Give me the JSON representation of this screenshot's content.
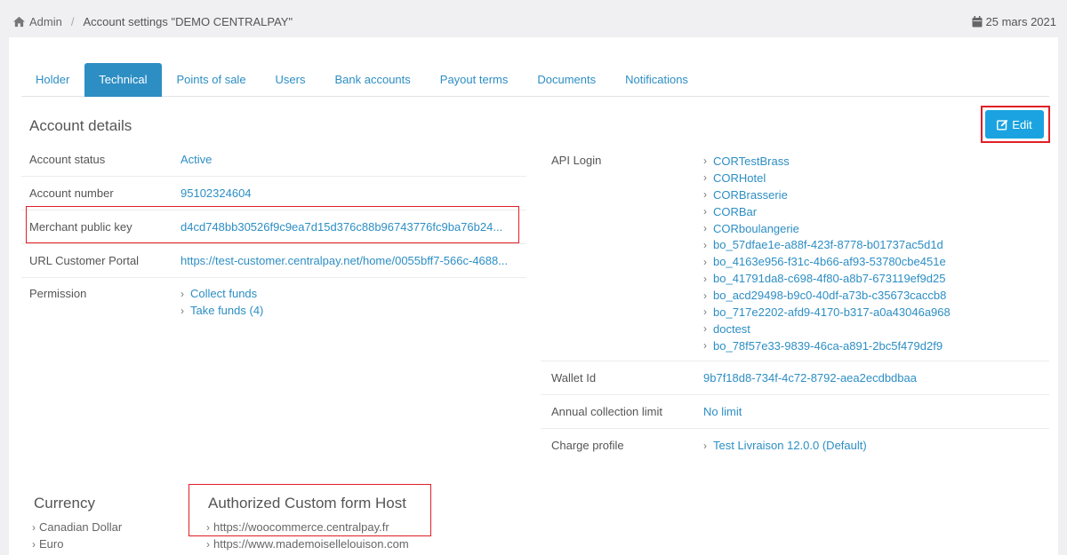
{
  "breadcrumb": {
    "home_icon": "home-icon",
    "root": "Admin",
    "separator": "/",
    "current": "Account settings \"DEMO CENTRALPAY\""
  },
  "date": {
    "icon": "calendar-icon",
    "text": "25 mars 2021"
  },
  "tabs": [
    {
      "label": "Holder",
      "active": false
    },
    {
      "label": "Technical",
      "active": true
    },
    {
      "label": "Points of sale",
      "active": false
    },
    {
      "label": "Users",
      "active": false
    },
    {
      "label": "Bank accounts",
      "active": false
    },
    {
      "label": "Payout terms",
      "active": false
    },
    {
      "label": "Documents",
      "active": false
    },
    {
      "label": "Notifications",
      "active": false
    }
  ],
  "section_title": "Account details",
  "edit_button": {
    "label": "Edit",
    "icon": "edit-icon",
    "color": "#1aa3e0"
  },
  "details": {
    "account_status": {
      "label": "Account status",
      "value": "Active"
    },
    "account_number": {
      "label": "Account number",
      "value": "95102324604"
    },
    "merchant_public_key": {
      "label": "Merchant public key",
      "value": "d4cd748bb30526f9c9ea7d15d376c88b96743776fc9ba76b24..."
    },
    "url_customer_portal": {
      "label": "URL Customer Portal",
      "value": "https://test-customer.centralpay.net/home/0055bff7-566c-4688..."
    },
    "permission": {
      "label": "Permission",
      "items": [
        "Collect funds",
        "Take funds (4)"
      ]
    }
  },
  "right_details": {
    "api_login": {
      "label": "API Login",
      "items": [
        "CORTestBrass",
        "CORHotel",
        "CORBrasserie",
        "CORBar",
        "CORboulangerie",
        "bo_57dfae1e-a88f-423f-8778-b01737ac5d1d",
        "bo_4163e956-f31c-4b66-af93-53780cbe451e",
        "bo_41791da8-c698-4f80-a8b7-673119ef9d25",
        "bo_acd29498-b9c0-40df-a73b-c35673caccb8",
        "bo_717e2202-afd9-4170-b317-a0a43046a968",
        "doctest",
        "bo_78f57e33-9839-46ca-a891-2bc5f479d2f9"
      ]
    },
    "wallet_id": {
      "label": "Wallet Id",
      "value": "9b7f18d8-734f-4c72-8792-aea2ecdbdbaa"
    },
    "annual_collection_limit": {
      "label": "Annual collection limit",
      "value": "No limit"
    },
    "charge_profile": {
      "label": "Charge profile",
      "value": "Test Livraison 12.0.0 (Default)"
    }
  },
  "currency": {
    "title": "Currency",
    "items": [
      "Canadian Dollar",
      "Euro"
    ]
  },
  "authorized_host": {
    "title": "Authorized Custom form Host",
    "items": [
      "https://woocommerce.centralpay.fr",
      "https://www.mademoisellelouison.com"
    ]
  },
  "colors": {
    "link": "#2d8ec4",
    "active_tab": "#2d8ec4",
    "highlight": "#e01f26"
  }
}
